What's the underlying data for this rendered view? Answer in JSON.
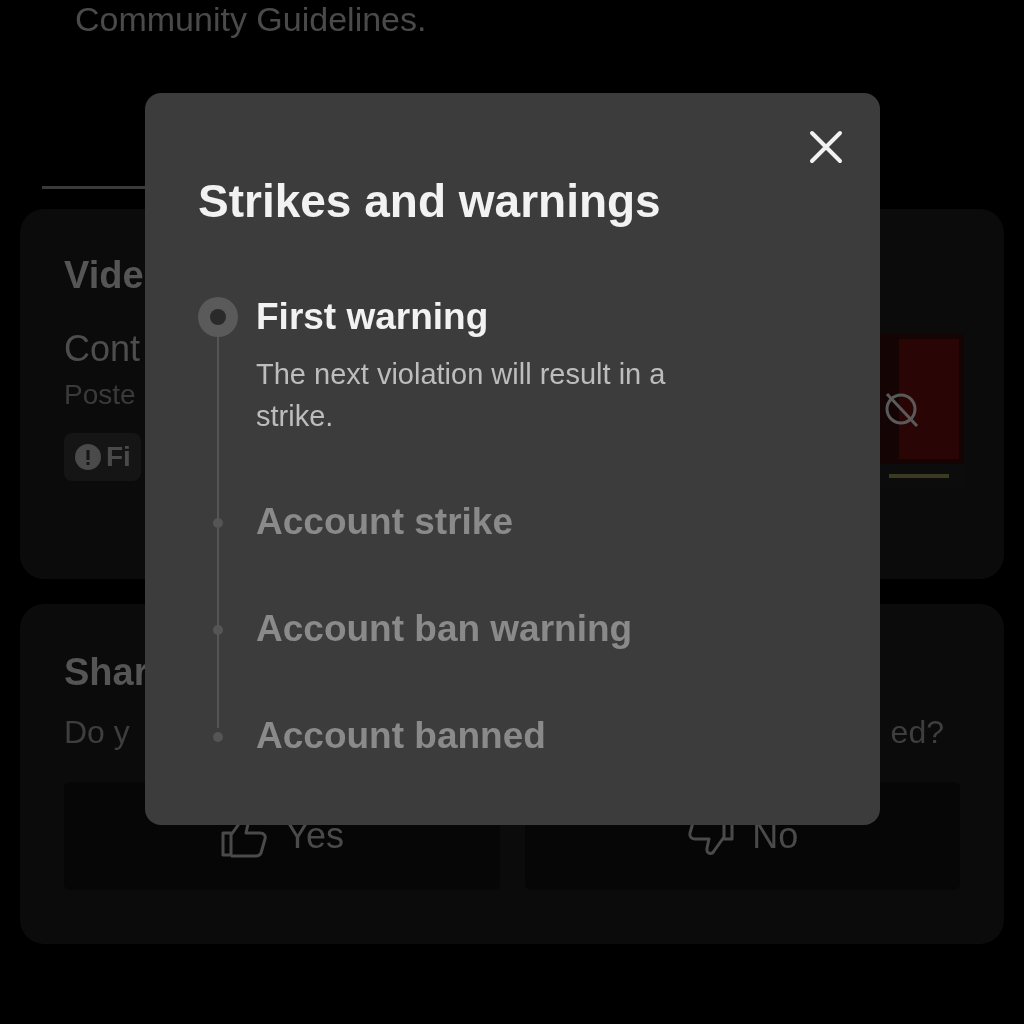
{
  "page": {
    "intro_text": "Community Guidelines.",
    "video_card": {
      "title": "Vide",
      "line_1": "Cont",
      "line_2": "Poste",
      "badge": "Fi"
    },
    "share_card": {
      "title": "Shar",
      "question_start": "Do y",
      "question_end": "ed?",
      "buttons": [
        {
          "kind": "yes",
          "label": "Yes"
        },
        {
          "kind": "no",
          "label": "No"
        }
      ]
    }
  },
  "modal": {
    "title": "Strikes and warnings",
    "steps": [
      {
        "label": "First warning",
        "description": "The next violation will result in a strike.",
        "selected": true
      },
      {
        "label": "Account strike",
        "selected": false
      },
      {
        "label": "Account ban warning",
        "selected": false
      },
      {
        "label": "Account banned",
        "selected": false
      }
    ]
  }
}
